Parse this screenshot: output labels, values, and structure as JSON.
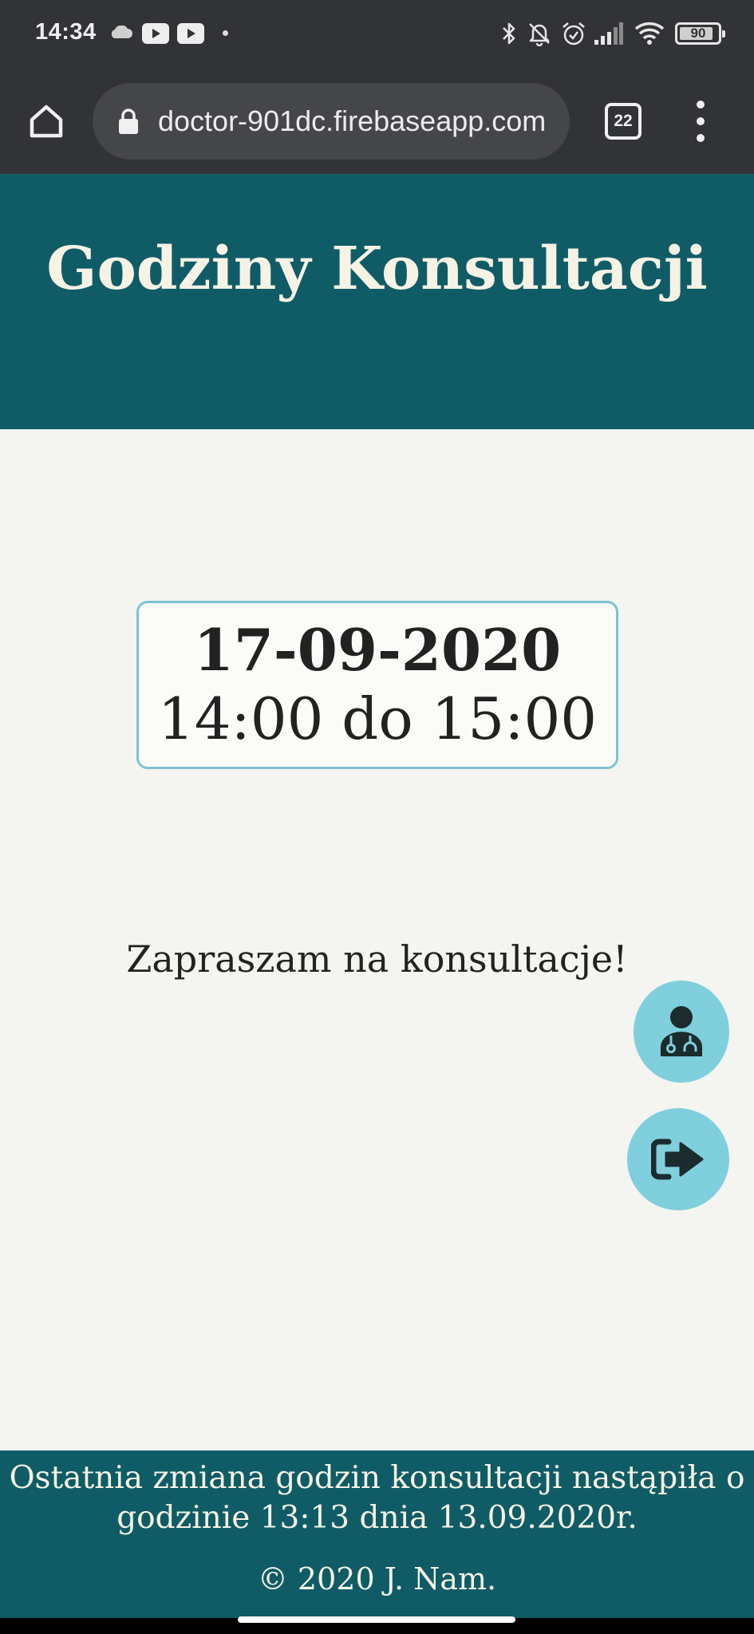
{
  "status_bar": {
    "time": "14:34",
    "battery_level": "90",
    "battery_fraction": 0.9,
    "icons": [
      "cloud-icon",
      "youtube-icon",
      "youtube-icon",
      "dot-icon",
      "bluetooth-icon",
      "bell-muted-icon",
      "alarm-icon",
      "signal-icon",
      "wifi-icon",
      "battery-icon"
    ]
  },
  "browser": {
    "url": "doctor-901dc.firebaseapp.com",
    "tab_count": "22",
    "icons": [
      "home-icon",
      "lock-icon",
      "tabs-icon",
      "more-vert-icon"
    ]
  },
  "header": {
    "title": "Godziny Konsultacji"
  },
  "consultation": {
    "date": "17-09-2020",
    "hours": "14:00 do 15:00"
  },
  "invite": "Zapraszam na konsultacje!",
  "fab": {
    "icons": [
      "doctor-icon",
      "logout-icon"
    ]
  },
  "footer": {
    "note_line1": "Ostatnia zmiana godzin konsultacji nastąpiła o",
    "note_line2": "godzinie 13:13 dnia 13.09.2020r.",
    "copyright": "© 2020 J. Nam."
  },
  "colors": {
    "status_bar": "#323336",
    "header": "#0f5c66",
    "background": "#f4f4f1",
    "card_border": "#7ec3d1",
    "fab": "#7fcfdc",
    "title_text": "#f6f3e4"
  }
}
